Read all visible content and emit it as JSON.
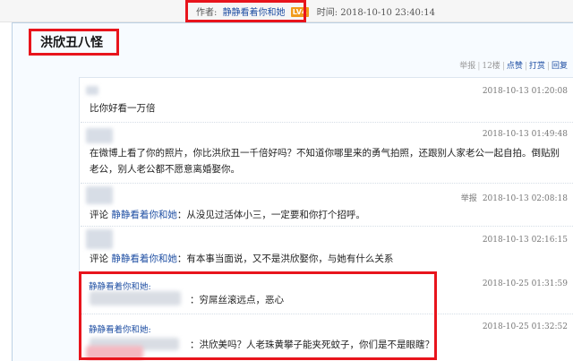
{
  "post_meta": {
    "author_label": "作者:",
    "author_name": "静静看着你和她",
    "level_badge": "LV4",
    "time_label": "时间:",
    "time_value": "2018-10-10 23:40:14"
  },
  "post": {
    "title": "洪欣丑八怪"
  },
  "actions": {
    "report": "举报",
    "floor": "12楼",
    "like": "点赞",
    "tip": "打赏",
    "reply": "回复",
    "separator": "|"
  },
  "comments": [
    {
      "time": "2018-10-13 01:20:08",
      "text": "比你好看一万倍"
    },
    {
      "time": "2018-10-13 01:49:48",
      "text": "在微博上看了你的照片，你比洪欣丑一千倍好吗？不知道你哪里来的勇气拍照，还跟别人家老公一起自拍。倒贴别",
      "text2": "老公，别人老公都不愿意离婚娶你。"
    },
    {
      "report": "举报",
      "time": "2018-10-13 02:08:18",
      "prefix": "评论",
      "name": "静静看着你和她",
      "text": "：从没见过活体小三，一定要和你打个招呼。"
    },
    {
      "time": "2018-10-13 02:16:15",
      "prefix": "评论",
      "name": "静静看着你和她",
      "text": "：有本事当面说，又不是洪欣娶你，与她有什么关系"
    }
  ],
  "replies": [
    {
      "name": "静静看着你和她:",
      "time": "2018-10-25 01:31:59",
      "text": "：穷屌丝滚远点，恶心"
    },
    {
      "name": "静静看着你和她:",
      "time": "2018-10-25 01:32:52",
      "text": "：洪欣美吗？人老珠黄攀子能夹死蚊子，你们是不是眼瞎？"
    }
  ],
  "colors": {
    "highlight_box": "#e8141c",
    "link": "#1f4fa3",
    "level_badge": "#f19b1c"
  }
}
